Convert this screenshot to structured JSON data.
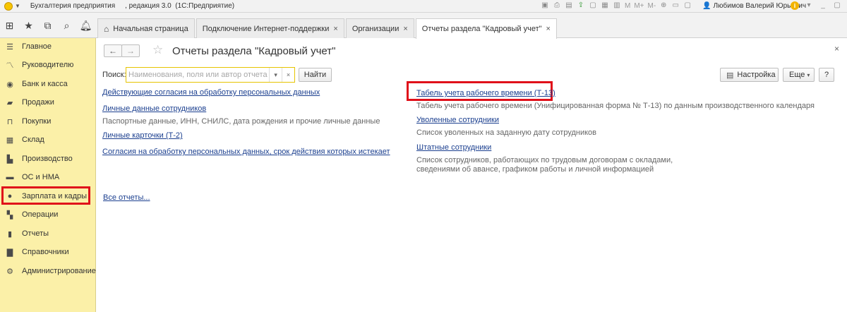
{
  "titlebar": {
    "title": "Бухгалтерия предприятия     , редакция 3.0  (1С:Предприятие)",
    "tool_texts": [
      "M",
      "M+",
      "M-"
    ],
    "user": "Любимов Валерий Юрьевич"
  },
  "top_icons": [
    "apps-grid-icon",
    "star-icon",
    "history-icon",
    "search-icon",
    "bell-icon"
  ],
  "tabs": [
    {
      "label": "Начальная страница"
    },
    {
      "label": "Подключение Интернет-поддержки"
    },
    {
      "label": "Организации"
    },
    {
      "label": "Отчеты раздела \"Кадровый учет\""
    }
  ],
  "sidebar": {
    "items": [
      {
        "label": "Главное",
        "icon": "menu-icon"
      },
      {
        "label": "Руководителю",
        "icon": "chart-line-icon"
      },
      {
        "label": "Банк и касса",
        "icon": "bank-icon"
      },
      {
        "label": "Продажи",
        "icon": "bag-icon"
      },
      {
        "label": "Покупки",
        "icon": "cart-icon"
      },
      {
        "label": "Склад",
        "icon": "warehouse-icon"
      },
      {
        "label": "Производство",
        "icon": "factory-icon"
      },
      {
        "label": "ОС и НМА",
        "icon": "truck-icon"
      },
      {
        "label": "Зарплата и кадры",
        "icon": "person-icon"
      },
      {
        "label": "Операции",
        "icon": "operations-icon"
      },
      {
        "label": "Отчеты",
        "icon": "bar-chart-icon"
      },
      {
        "label": "Справочники",
        "icon": "book-icon"
      },
      {
        "label": "Администрирование",
        "icon": "gear-icon"
      }
    ]
  },
  "main": {
    "title": "Отчеты раздела \"Кадровый учет\"",
    "search_label": "Поиск:",
    "search_placeholder": "Наименования, поля или автор отчета",
    "find_button": "Найти",
    "settings_button": "Настройка",
    "more_button": "Еще",
    "help_button": "?",
    "left_column": {
      "consent_link": "Действующие согласия на обработку персональных данных",
      "personal_data_link": "Личные данные сотрудников",
      "personal_data_desc": "Паспортные данные, ИНН, СНИЛС, дата рождения и прочие личные данные",
      "personal_cards_link": "Личные карточки (Т-2)",
      "expiring_consent_link": "Согласия на обработку персональных данных, срок действия которых истекает",
      "all_reports_link": "Все отчеты..."
    },
    "right_column": {
      "timesheet_link": "Табель учета рабочего времени (Т-13)",
      "timesheet_desc": "Табель учета рабочего времени (Унифицированная форма № Т-13) по данным производственного календаря",
      "dismissed_link": "Уволенные сотрудники",
      "dismissed_desc": "Список уволенных на заданную дату сотрудников",
      "staff_link": "Штатные сотрудники",
      "staff_desc_line1": "Список сотрудников, работающих по трудовым договорам с окладами,",
      "staff_desc_line2": "сведениями об авансе, графиком работы и личной информацией"
    }
  },
  "colors": {
    "sidebar_bg": "#fbf0a8",
    "link": "#1b3f8f",
    "highlight": "#e0101a",
    "search_border": "#e6c400"
  }
}
